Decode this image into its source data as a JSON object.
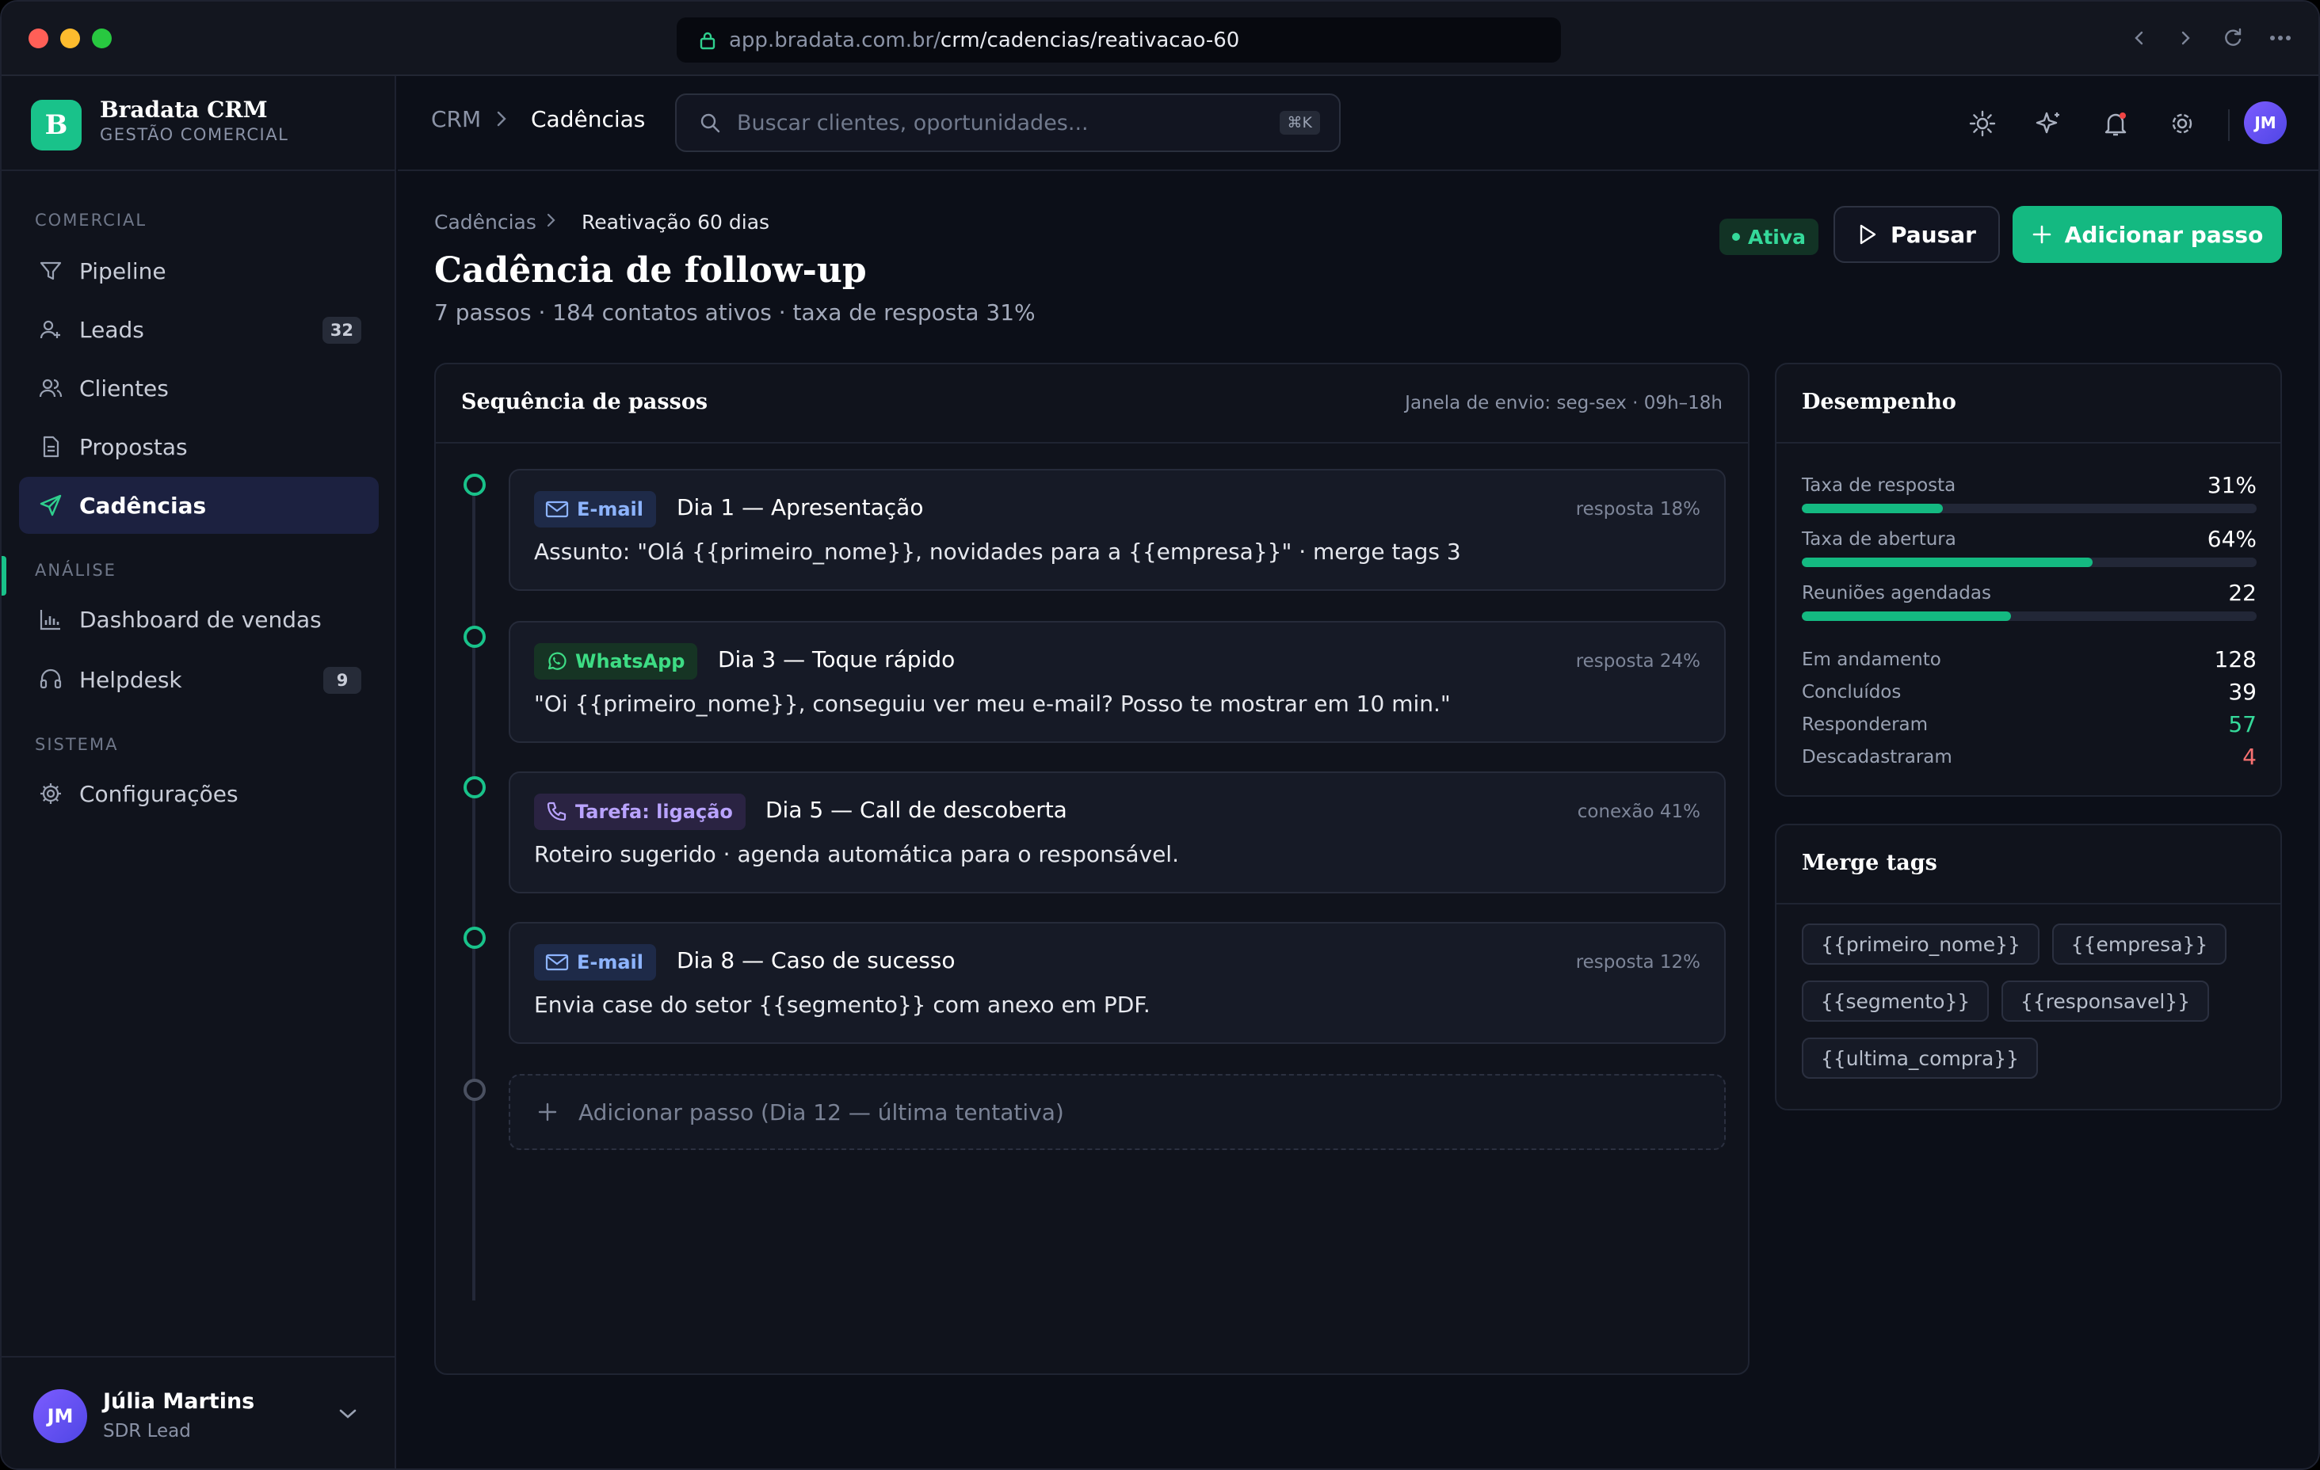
{
  "browser": {
    "url_host": "app.bradata.com.br/",
    "url_path": "crm/cadencias/reativacao-60"
  },
  "brand": {
    "name": "Bradata CRM",
    "subtitle": "GESTÃO COMERCIAL",
    "logo_letter": "B"
  },
  "sidebar": {
    "sections": [
      {
        "label": "COMERCIAL"
      },
      {
        "label": "ANÁLISE"
      },
      {
        "label": "SISTEMA"
      }
    ],
    "items": [
      {
        "label": "Pipeline",
        "icon": "filter-icon"
      },
      {
        "label": "Leads",
        "icon": "user-plus-icon",
        "badge": "32"
      },
      {
        "label": "Clientes",
        "icon": "users-icon"
      },
      {
        "label": "Propostas",
        "icon": "document-icon"
      },
      {
        "label": "Cadências",
        "icon": "send-icon",
        "active": true
      },
      {
        "label": "Dashboard de vendas",
        "icon": "bar-chart-icon"
      },
      {
        "label": "Helpdesk",
        "icon": "headset-icon",
        "badge": "9"
      },
      {
        "label": "Configurações",
        "icon": "gear-icon"
      }
    ]
  },
  "user": {
    "name": "Júlia Martins",
    "role": "SDR Lead",
    "initials": "JM"
  },
  "topbar": {
    "breadcrumb": [
      "CRM",
      "Cadências"
    ],
    "search_placeholder": "Buscar clientes, oportunidades...",
    "search_shortcut": "⌘K",
    "avatar_initials": "JM"
  },
  "page": {
    "breadcrumb": [
      "Cadências",
      "Reativação 60 dias"
    ],
    "title": "Cadência de follow-up",
    "subtitle": "7 passos · 184 contatos ativos · taxa de resposta 31%",
    "status": "Ativa",
    "pause_label": "Pausar",
    "add_label": "Adicionar passo"
  },
  "sequence": {
    "title": "Sequência de passos",
    "window": "Janela de envio: seg-sex · 09h–18h",
    "steps": [
      {
        "channel": "E-mail",
        "kind": "email",
        "title": "Dia 1 — Apresentação",
        "metric": "resposta 18%",
        "body": "Assunto: \"Olá {{primeiro_nome}}, novidades para a {{empresa}}\" · merge tags 3"
      },
      {
        "channel": "WhatsApp",
        "kind": "wa",
        "title": "Dia 3 — Toque rápido",
        "metric": "resposta 24%",
        "body": "\"Oi {{primeiro_nome}}, conseguiu ver meu e-mail? Posso te mostrar em 10 min.\""
      },
      {
        "channel": "Tarefa: ligação",
        "kind": "task",
        "title": "Dia 5 — Call de descoberta",
        "metric": "conexão 41%",
        "body": "Roteiro sugerido · agenda automática para o responsável."
      },
      {
        "channel": "E-mail",
        "kind": "email",
        "title": "Dia 8 — Caso de sucesso",
        "metric": "resposta 12%",
        "body": "Envia case do setor {{segmento}} com anexo em PDF."
      }
    ],
    "add_step": "Adicionar passo (Dia 12 — última tentativa)"
  },
  "performance": {
    "title": "Desempenho",
    "bars": [
      {
        "label": "Taxa de resposta",
        "value": "31%",
        "fill": 0.31
      },
      {
        "label": "Taxa de abertura",
        "value": "64%",
        "fill": 0.64
      },
      {
        "label": "Reuniões agendadas",
        "value": "22",
        "fill": 0.46
      }
    ],
    "stats": [
      {
        "label": "Em andamento",
        "value": "128",
        "color": "#ffffff"
      },
      {
        "label": "Concluídos",
        "value": "39",
        "color": "#ffffff"
      },
      {
        "label": "Responderam",
        "value": "57",
        "color": "#35d99a"
      },
      {
        "label": "Descadastraram",
        "value": "4",
        "color": "#f87171"
      }
    ]
  },
  "merge_tags": {
    "title": "Merge tags",
    "tags": [
      "{{primeiro_nome}}",
      "{{empresa}}",
      "{{segmento}}",
      "{{responsavel}}",
      "{{ultima_compra}}"
    ]
  },
  "colors": {
    "accent": "#14b981",
    "background": "#0c0f18",
    "danger": "#f87171"
  }
}
